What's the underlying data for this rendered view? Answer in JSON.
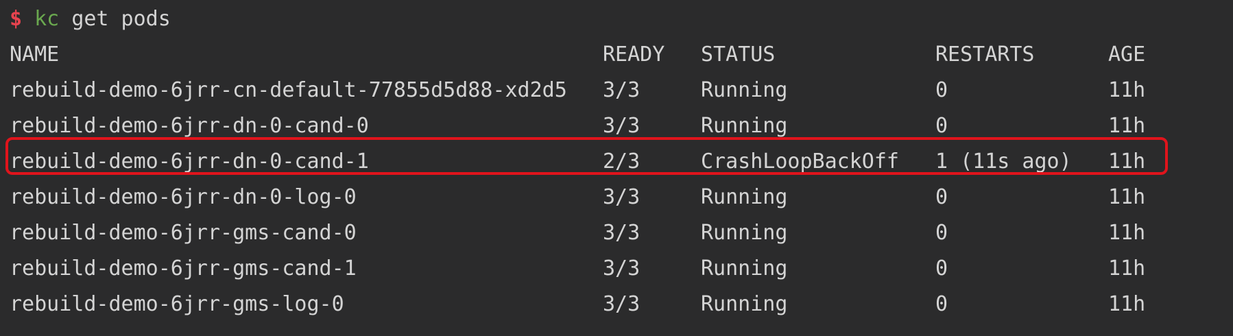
{
  "prompt": {
    "symbol": "$",
    "command": "kc",
    "args": "get pods"
  },
  "table": {
    "headers": {
      "name": "NAME",
      "ready": "READY",
      "status": "STATUS",
      "restarts": "RESTARTS",
      "age": "AGE"
    },
    "rows": [
      {
        "name": "rebuild-demo-6jrr-cn-default-77855d5d88-xd2d5",
        "ready": "3/3",
        "status": "Running",
        "restarts": "0",
        "age": "11h"
      },
      {
        "name": "rebuild-demo-6jrr-dn-0-cand-0",
        "ready": "3/3",
        "status": "Running",
        "restarts": "0",
        "age": "11h"
      },
      {
        "name": "rebuild-demo-6jrr-dn-0-cand-1",
        "ready": "2/3",
        "status": "CrashLoopBackOff",
        "restarts": "1 (11s ago)",
        "age": "11h"
      },
      {
        "name": "rebuild-demo-6jrr-dn-0-log-0",
        "ready": "3/3",
        "status": "Running",
        "restarts": "0",
        "age": "11h"
      },
      {
        "name": "rebuild-demo-6jrr-gms-cand-0",
        "ready": "3/3",
        "status": "Running",
        "restarts": "0",
        "age": "11h"
      },
      {
        "name": "rebuild-demo-6jrr-gms-cand-1",
        "ready": "3/3",
        "status": "Running",
        "restarts": "0",
        "age": "11h"
      },
      {
        "name": "rebuild-demo-6jrr-gms-log-0",
        "ready": "3/3",
        "status": "Running",
        "restarts": "0",
        "age": "11h"
      }
    ]
  },
  "highlight": {
    "color": "#e0141c",
    "row": "rebuild-demo-6jrr-dn-0-cand-1"
  },
  "colors": {
    "background": "#2b2b2c",
    "text": "#d4d4d4",
    "prompt_symbol": "#e8434f",
    "command": "#6aa84f"
  }
}
